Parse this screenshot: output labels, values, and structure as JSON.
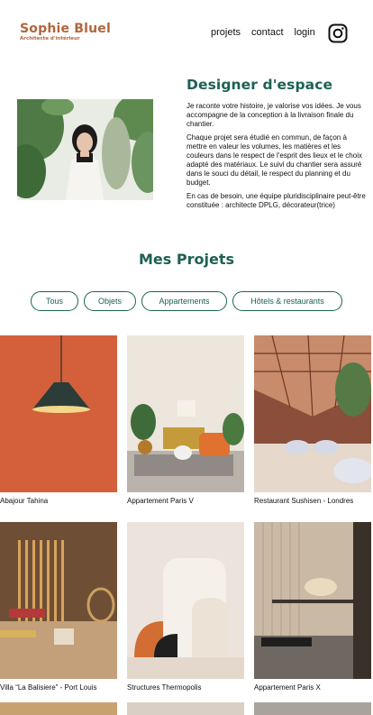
{
  "header": {
    "logo_name": "Sophie Bluel",
    "logo_subtitle": "Architecte d'intérieur",
    "nav": [
      "projets",
      "contact",
      "login"
    ],
    "instagram_icon": "instagram-icon"
  },
  "intro": {
    "title": "Designer d'espace",
    "paragraphs": [
      "Je raconte votre histoire, je valorise vos idées. Je vous accompagne de la conception à la livraison finale du chantier.",
      "Chaque projet sera étudié en commun, de façon à mettre en valeur les volumes, les matières et les couleurs dans le respect de l'esprit des lieux et le choix adapté des matériaux. Le suivi du chantier sera assuré dans le souci du détail, le respect du planning et du budget.",
      "En cas de besoin, une équipe pluridisciplinaire peut-être constituée : architecte DPLG, décorateur(trice)"
    ]
  },
  "projects": {
    "title": "Mes Projets",
    "filters": [
      "Tous",
      "Objets",
      "Appartements",
      "Hôtels & restaurants"
    ],
    "items": [
      {
        "caption": "Abajour Tahina"
      },
      {
        "caption": "Appartement Paris V"
      },
      {
        "caption": "Restaurant Sushisen - Londres"
      },
      {
        "caption": "Villa “La Balisiere” - Port Louis"
      },
      {
        "caption": "Structures Thermopolis"
      },
      {
        "caption": "Appartement Paris X"
      }
    ]
  },
  "colors": {
    "brand": "#B1663C",
    "accent": "#1D6154"
  }
}
